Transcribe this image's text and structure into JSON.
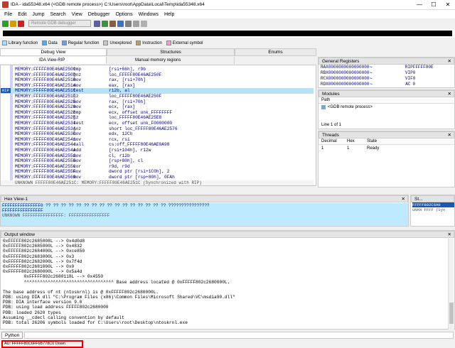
{
  "window": {
    "title": "IDA - ida55348.x64 (<GDB remote process>) C:\\Users\\root\\AppData\\Local\\Temp\\ida55348.x64",
    "minimize": "—",
    "maximize": "☐",
    "close": "✕"
  },
  "menu": [
    "File",
    "Edit",
    "Jump",
    "Search",
    "View",
    "Debugger",
    "Options",
    "Windows",
    "Help"
  ],
  "toolbar": {
    "debugger_select": "Remote GDB debugger",
    "colors": [
      "#2e9e2e",
      "#d0a000",
      "#d02020",
      "#6060a0",
      "#409040",
      "#806040",
      "#4070c0",
      "#808080"
    ]
  },
  "legend": [
    {
      "label": "Library function",
      "color": "#a8dcff"
    },
    {
      "label": "Data",
      "color": "#55a8e8"
    },
    {
      "label": "Regular function",
      "color": "#6fa0d8"
    },
    {
      "label": "Unexplored",
      "color": "#c8c8c8"
    },
    {
      "label": "Instruction",
      "color": "#b0a070"
    },
    {
      "label": "External symbol",
      "color": "#ff99cc"
    }
  ],
  "main_tabs": [
    {
      "label": "Debug View",
      "active": true
    },
    {
      "label": "Structures",
      "active": false
    },
    {
      "label": "Enums",
      "active": false
    }
  ],
  "sub_tabs": [
    {
      "label": "IDA View-RIP",
      "active": true
    },
    {
      "label": "Manual memory regions",
      "active": false
    }
  ],
  "disasm": {
    "rip_marker": "RIP",
    "lines": [
      {
        "addr": "MEMORY:FFFFF80E46AE2509",
        "mn": "cmp",
        "op": "[rsi+66h], r9b"
      },
      {
        "addr": "MEMORY:FFFFF80E46AE250D",
        "mn": "jnz",
        "op": "loc_FFFFF80E46AE250F"
      },
      {
        "addr": "MEMORY:FFFFF80E46AE2510",
        "mn": "mov",
        "op": "rax, [rsi+70h]"
      },
      {
        "addr": "MEMORY:FFFFF80E46AE2514",
        "mn": "mov",
        "op": "eax, [rax]"
      },
      {
        "addr": "MEMORY:FFFFF80E46AE251C",
        "mn": "test",
        "op": "r12b, al"
      },
      {
        "addr": "MEMORY:FFFFF80E46AE251F",
        "mn": "jz",
        "op": "loc_FFFFF80E46AE250F"
      },
      {
        "addr": "MEMORY:FFFFF80E46AE2525",
        "mn": "mov",
        "op": "rax, [rsi+70h]"
      },
      {
        "addr": "MEMORY:FFFFF80E46AE2529",
        "mn": "mov",
        "op": "ecx, [rax]"
      },
      {
        "addr": "MEMORY:FFFFF80E46AE252B",
        "mn": "cmp",
        "op": "ecx, offset unk_FFFFFFFF"
      },
      {
        "addr": "MEMORY:FFFFF80E46AE252E",
        "mn": "jz",
        "op": "loc_FFFFF80E46AE25E8"
      },
      {
        "addr": "MEMORY:FFFFF80E46AE2534",
        "mn": "test",
        "op": "ecx, offset unk_F0000000"
      },
      {
        "addr": "MEMORY:FFFFF80E46AE253A",
        "mn": "jnz",
        "op": "short loc_FFFFF80E46AE2576"
      },
      {
        "addr": "MEMORY:FFFFF80E46AE253C",
        "mn": "mov",
        "op": "edx, 12Ch"
      },
      {
        "addr": "MEMORY:FFFFF80E46AE2541",
        "mn": "mov",
        "op": "rcx, rsi"
      },
      {
        "addr": "MEMORY:FFFFF80E46AE2544",
        "mn": "call",
        "op": "cs:off_FFFFF80E46AE0A98"
      },
      {
        "addr": "MEMORY:FFFFF80E46AE254A",
        "mn": "add",
        "op": "[rsi+104h], r12w"
      },
      {
        "addr": "MEMORY:FFFFF80E46AE2552",
        "mn": "mov",
        "op": "cl, r12b"
      },
      {
        "addr": "MEMORY:FFFFF80E46AE2555",
        "mn": "mov",
        "op": "[rsp+80h], cl"
      },
      {
        "addr": "MEMORY:FFFFF80E46AE255C",
        "mn": "xor",
        "op": "r9d, r9d"
      },
      {
        "addr": "MEMORY:FFFFF80E46AE255F",
        "mn": "mov",
        "op": "dword ptr [rsi+1C0h], 2"
      },
      {
        "addr": "MEMORY:FFFFF80E46AE2569",
        "mn": "mov",
        "op": "dword ptr [rsp+80h], 0FAh"
      }
    ],
    "highlight_index": 4,
    "status": "UNKNOWN FFFFF80E46AE251C: MEMORY:FFFFF80E46AE251C (Synchronized with RIP)"
  },
  "registers": {
    "title": "General Registers",
    "rows": [
      {
        "n1": "RAX",
        "v1": "0000000000000000",
        "n2": "RIP",
        "v2": "FFFFF80E"
      },
      {
        "n1": "RBX",
        "v1": "0000000000000000",
        "n2": "VIP",
        "v2": "0"
      },
      {
        "n1": "RCX",
        "v1": "0000000000000000",
        "n2": "VIF",
        "v2": "0"
      },
      {
        "n1": "RDX",
        "v1": "0000000000000000",
        "n2": "AC",
        "v2": "0"
      }
    ]
  },
  "modules": {
    "title": "Modules",
    "col": "Path",
    "rows": [
      "<GDB remote process>"
    ],
    "footer": "Line 1 of 1"
  },
  "threads": {
    "title": "Threads",
    "cols": [
      "Decimal",
      "Hex",
      "State"
    ],
    "rows": [
      [
        "1",
        "1",
        "Ready"
      ]
    ]
  },
  "hex": {
    "title": "Hex View-1",
    "lines": [
      "FFFFFFFFFFFFFFF0  ?? ?? ?? ?? ?? ?? ?? ?? ?? ?? ?? ?? ?? ?? ?? ??  ????????????????",
      "FFFFFFFFFFFFFFFF",
      "",
      "UNKNOWN FFFFFFFFFFFFFFFF: FFFFFFFFFFFFFFFF"
    ]
  },
  "stack": {
    "title": "St...",
    "lines": [
      "FFFFF802C6A0",
      "UNKN FFFF (Syn"
    ]
  },
  "output": {
    "title": "Output window",
    "lines": [
      "0xFFFFF802c2685008L --> 0x4d0d8",
      "0xFFFFF802c2685000L --> 0x4832",
      "0xFFFFF802c2684000L --> 0xce850",
      "0xFFFFF802c2683000L --> 0x3",
      "0xFFFFF802c2682000L --> 0x7f4d",
      "0xFFFFF802c2681000L --> 0x0",
      "0xFFFFF802c2680000L --> 0x5a4d",
      "        0xFFFFF802c2680118L --> 0x4550",
      "        ^^^^^^^^^^^^^^^^^^^^^^^^^^^^^^^^^^ Base address located @ 0xFFFFF802c2680000L.",
      "",
      "The base address of nt (ntoskrnl) is @ 0xFFFFF802c2680000L.",
      "PDB: using DIA dll \"C:\\Program Files (x86)\\Common Files\\Microsoft Shared\\VC\\msdia90.dll\"",
      "PDB: DIA interface version 9.0",
      "PDB: using load address FFFFF802c2680000",
      "PDB: loaded 2620 types",
      "Assuming __cdecl calling convention by default",
      "PDB: total 26206 symbols loaded for C:\\Users\\root\\Desktop\\ntoskrnl.exe"
    ]
  },
  "cmdbar": {
    "lang": "Python"
  },
  "statusbar": {
    "text": "AU: FFFFF80C6FF6B778C0  Down"
  }
}
